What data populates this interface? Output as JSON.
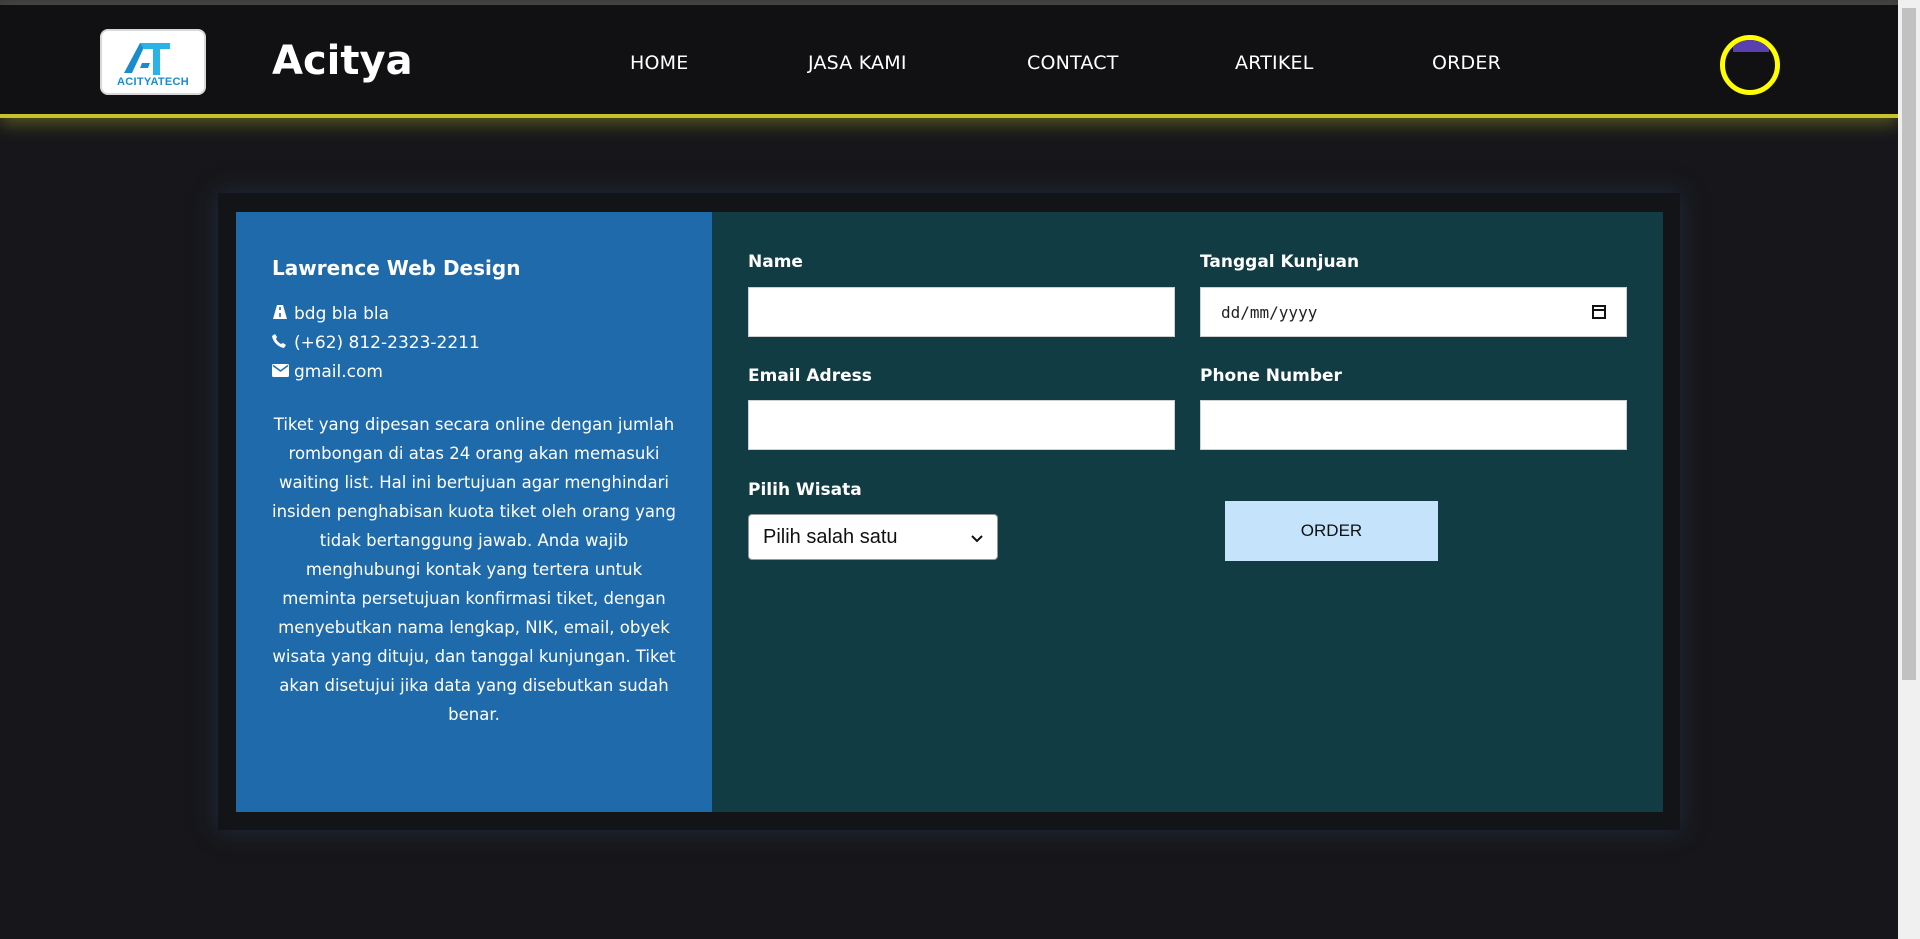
{
  "header": {
    "logo_text": "ACITYATECH",
    "brand": "Acitya",
    "nav": [
      "HOME",
      "JASA KAMI",
      "CONTACT",
      "ARTIKEL",
      "ORDER"
    ]
  },
  "info": {
    "title": "Lawrence Web Design",
    "address": "bdg bla bla",
    "phone": "(+62) 812-2323-2211",
    "email": "gmail.com",
    "description": "Tiket yang dipesan secara online dengan jumlah rombongan di atas 24 orang akan memasuki waiting list. Hal ini bertujuan agar menghindari insiden penghabisan kuota tiket oleh orang yang tidak bertanggung jawab. Anda wajib menghubungi kontak yang tertera untuk meminta persetujuan konfirmasi tiket, dengan menyebutkan nama lengkap, NIK, email, obyek wisata yang dituju, dan tanggal kunjungan. Tiket akan disetujui jika data yang disebutkan sudah benar."
  },
  "form": {
    "name_label": "Name",
    "date_label": "Tanggal Kunjuan",
    "date_placeholder": "dd/mm/yyyy",
    "email_label": "Email Adress",
    "phone_label": "Phone Number",
    "wisata_label": "Pilih Wisata",
    "wisata_selected": "Pilih salah satu",
    "order_button": "ORDER"
  },
  "colors": {
    "accent": "#ffff00",
    "left_panel": "#1e6aab",
    "right_panel": "#123c44",
    "order_button": "#c5e3fb"
  }
}
